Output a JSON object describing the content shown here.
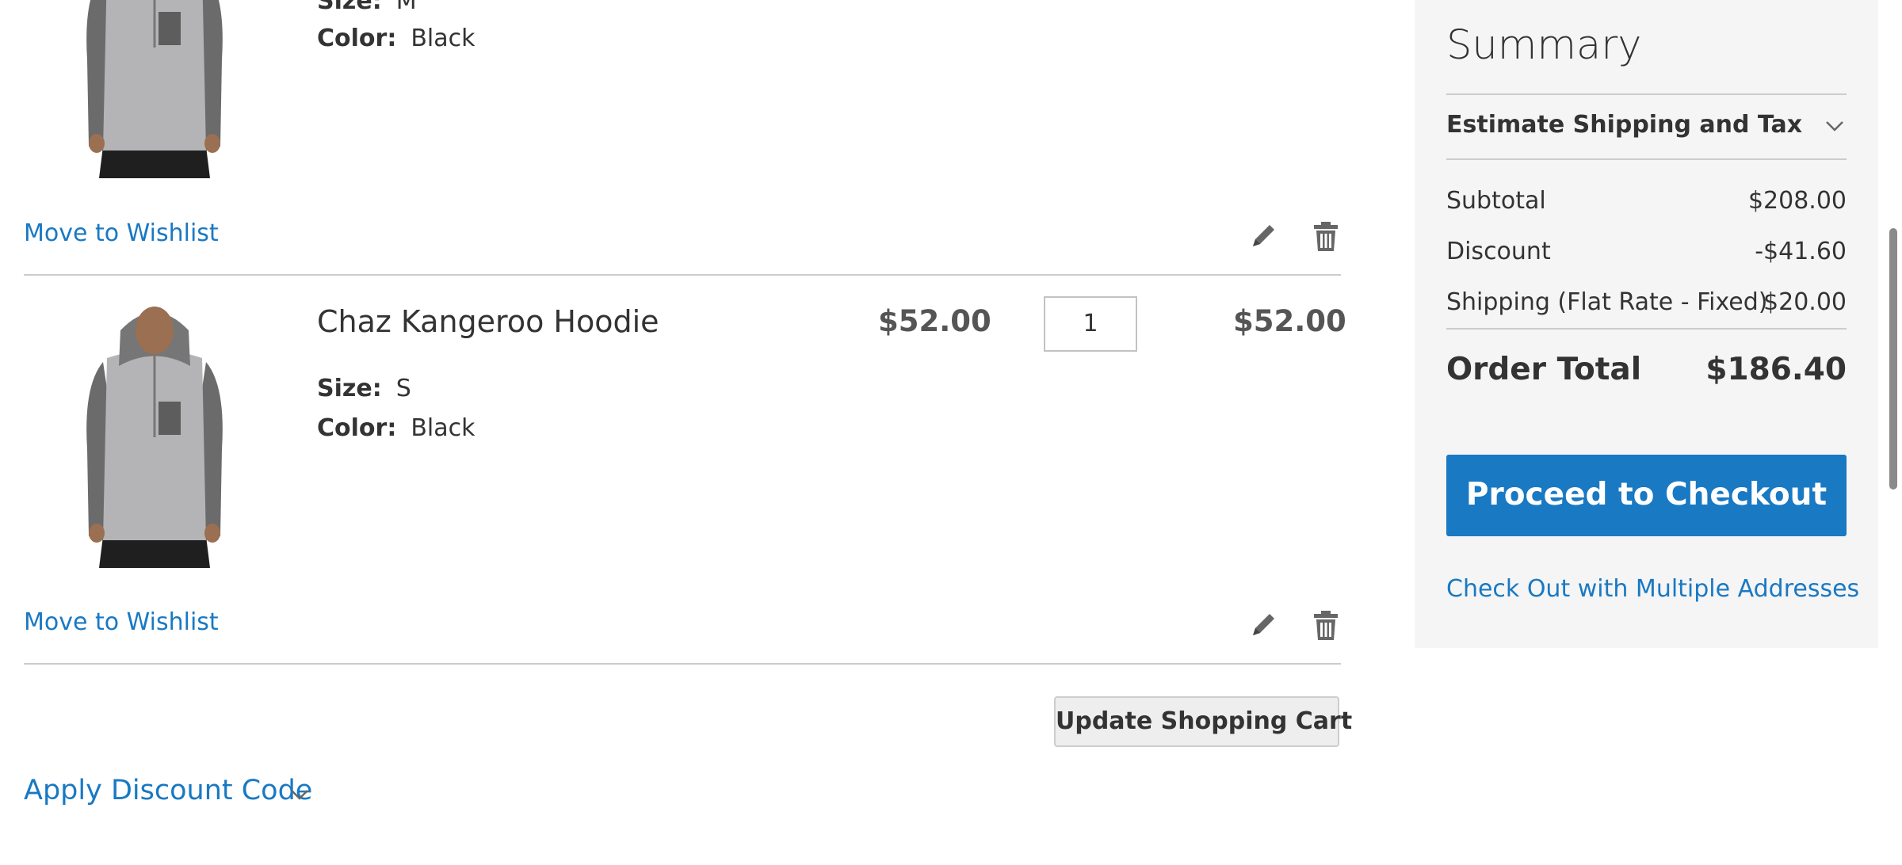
{
  "cart": {
    "items": [
      {
        "name": "",
        "price": "",
        "subtotal": "",
        "qty": "",
        "size_label": "Size:",
        "size_value": "M",
        "color_label": "Color:",
        "color_value": "Black",
        "wishlist_label": "Move to Wishlist",
        "image_icon": "hoodie-image"
      },
      {
        "name": "Chaz Kangeroo Hoodie",
        "price": "$52.00",
        "subtotal": "$52.00",
        "qty": "1",
        "size_label": "Size:",
        "size_value": "S",
        "color_label": "Color:",
        "color_value": "Black",
        "wishlist_label": "Move to Wishlist",
        "image_icon": "hoodie-image"
      }
    ],
    "update_label": "Update Shopping Cart",
    "discount_label": "Apply Discount Code",
    "icons": {
      "edit": "pencil-icon",
      "delete": "trash-icon",
      "expand": "chevron-down-icon"
    }
  },
  "summary": {
    "title": "Summary",
    "estimate_label": "Estimate Shipping and Tax",
    "rows": [
      {
        "label": "Subtotal",
        "value": "$208.00"
      },
      {
        "label": "Discount",
        "value": "-$41.60"
      },
      {
        "label": "Shipping (Flat Rate - Fixed)",
        "value": "$20.00"
      }
    ],
    "total_label": "Order Total",
    "total_value": "$186.40",
    "checkout_label": "Proceed to Checkout",
    "multi_label": "Check Out with Multiple Addresses"
  },
  "colors": {
    "accent": "#1979c3",
    "text": "#333333",
    "summary_bg": "#f5f5f5"
  }
}
